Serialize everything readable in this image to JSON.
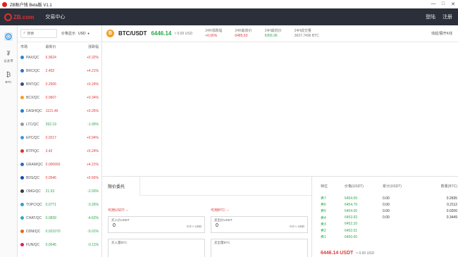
{
  "window": {
    "title": "ZB账户钱 Beta版 V1.1",
    "controls": [
      "—",
      "□",
      "✕"
    ]
  },
  "nav": {
    "logo": "ZB.com",
    "exchange_center": "交易中心",
    "login": "登陆",
    "register": "注册"
  },
  "rail": {
    "items": [
      {
        "label": "",
        "icon": "coin-icon"
      },
      {
        "label": "以太币",
        "icon": "tether-icon"
      },
      {
        "label": "BTC",
        "icon": "bitcoin-icon"
      }
    ]
  },
  "market": {
    "search_placeholder": "搜索",
    "price_label": "价格显示",
    "currency": "USD",
    "headers": {
      "pair": "市场",
      "price": "最新价",
      "change": "涨跌幅"
    },
    "rows": [
      {
        "pair": "PAX/QC",
        "price": "6.9624",
        "change": "+0.32%",
        "dir": "up",
        "color": "#2a8ad0"
      },
      {
        "pair": "BRC/QC",
        "price": "2.402",
        "change": "+4.21%",
        "dir": "up",
        "color": "#3a6bc8"
      },
      {
        "pair": "BNT/QC",
        "price": "0.2506",
        "change": "+0.24%",
        "dir": "up",
        "color": "#334d99"
      },
      {
        "pair": "BCX/QC",
        "price": "0.0607",
        "change": "+0.34%",
        "dir": "up",
        "color": "#f0a020"
      },
      {
        "pair": "DASH/QC",
        "price": "1121.46",
        "change": "+0.26%",
        "dir": "up",
        "color": "#2a7ad0"
      },
      {
        "pair": "LTC/QC",
        "price": "352.19",
        "change": "-1.90%",
        "dir": "down",
        "color": "#9a9a9a"
      },
      {
        "pair": "EPC/QC",
        "price": "0.0217",
        "change": "+0.94%",
        "dir": "up",
        "color": "#3a9ae0"
      },
      {
        "pair": "BTP/QC",
        "price": "3.42",
        "change": "+5.24%",
        "dir": "up",
        "color": "#e03030"
      },
      {
        "pair": "GRAM/QC",
        "price": "0.000992",
        "change": "+4.21%",
        "dir": "up",
        "color": "#2a6ad0"
      },
      {
        "pair": "BDS/QC",
        "price": "0.0546",
        "change": "+0.56%",
        "dir": "up",
        "color": "#1a4ab0"
      },
      {
        "pair": "OMG/QC",
        "price": "21.53",
        "change": "-2.93%",
        "dir": "down",
        "color": "#3a3a3a"
      },
      {
        "pair": "TOPC/QC",
        "price": "0.0771",
        "change": "-3.26%",
        "dir": "down",
        "color": "#2aa0e0"
      },
      {
        "pair": "CHAT/QC",
        "price": "0.0839",
        "change": "-4.62%",
        "dir": "down",
        "color": "#2ab0c0"
      },
      {
        "pair": "DDM/QC",
        "price": "0.021070",
        "change": "-5.01%",
        "dir": "down",
        "color": "#e06a20"
      },
      {
        "pair": "FUN/QC",
        "price": "0.0045",
        "change": "-0.11%",
        "dir": "down",
        "color": "#e02050"
      }
    ]
  },
  "ticker": {
    "pair": "BTC/USDT",
    "price": "6446.14",
    "approx": "≈ 0.00 USD",
    "stats": [
      {
        "label": "24H涨跌幅",
        "value": "+0.06%",
        "tone": "red"
      },
      {
        "label": "24H最高价",
        "value": "6485.63",
        "tone": "red"
      },
      {
        "label": "24H最低价",
        "value": "6356.96",
        "tone": "green"
      },
      {
        "label": "24H成交量",
        "value": "3637.7496 BTC",
        "tone": "gray"
      }
    ],
    "expand": "收起/展开K线"
  },
  "orders": {
    "tabs": [
      "限价委托",
      ""
    ],
    "buy": {
      "avail": "可用USDT: --",
      "price_label": "买入价USDT",
      "price_value": "0",
      "price_unit": "0.0 ≈ USD",
      "amount_label": "买入量BTC"
    },
    "sell": {
      "avail": "可用BTC: --",
      "price_label": "卖出价USDT",
      "price_value": "0",
      "price_unit": "0.0 ≈ USD",
      "amount_label": "卖出量BTC"
    }
  },
  "book": {
    "headers": {
      "side": "档位",
      "price": "价格(USDT)",
      "total": "累计(USDT)",
      "amount": "数量(BTC)"
    },
    "rows": [
      {
        "side": "卖7",
        "price": "6454.09",
        "total": "0.00",
        "amount": "0.2695"
      },
      {
        "side": "卖6",
        "price": "6454.79",
        "total": "0.00",
        "amount": "0.2112"
      },
      {
        "side": "卖5",
        "price": "6454.00",
        "total": "0.00",
        "amount": "0.0200"
      },
      {
        "side": "卖4",
        "price": "6453.93",
        "total": "0.00",
        "amount": "0.3449"
      },
      {
        "side": "卖3",
        "price": "6452.10",
        "total": "",
        "amount": ""
      },
      {
        "side": "卖2",
        "price": "6452.01",
        "total": "",
        "amount": ""
      },
      {
        "side": "卖1",
        "price": "6450.00",
        "total": "",
        "amount": ""
      }
    ],
    "last_price": "6446.14 USDT",
    "last_approx": "≈ 0.00 USD"
  }
}
